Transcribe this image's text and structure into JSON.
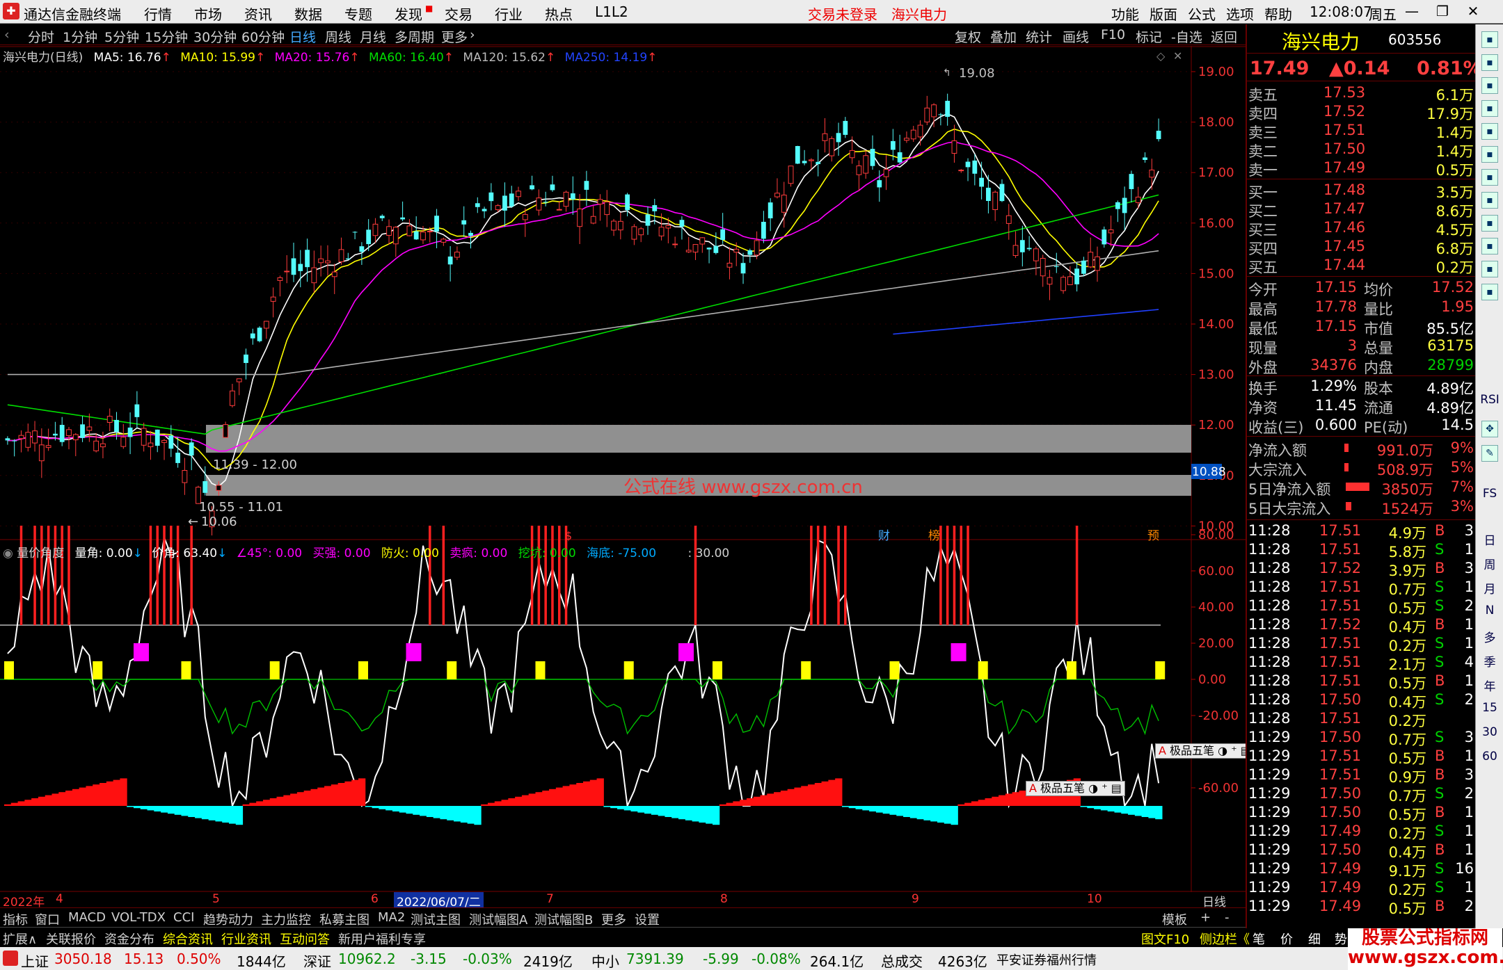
{
  "menubar": {
    "app": "通达信金融终端",
    "items": [
      "行情",
      "市场",
      "资讯",
      "数据",
      "专题",
      "发现",
      "交易",
      "行业",
      "热点",
      "L1L2"
    ],
    "notice": "交易未登录",
    "stock_link": "海兴电力",
    "right": [
      "功能",
      "版面",
      "公式",
      "选项",
      "帮助"
    ],
    "time": "12:08:07",
    "weekday": "周五"
  },
  "periods": [
    "分时",
    "1分钟",
    "5分钟",
    "15分钟",
    "30分钟",
    "60分钟",
    "日线",
    "周线",
    "月线",
    "多周期",
    "更多"
  ],
  "active_period": "日线",
  "toolbar": [
    "复权",
    "叠加",
    "统计",
    "画线",
    "F10",
    "标记",
    "-自选",
    "返回"
  ],
  "ma_legend": {
    "title": "海兴电力(日线)",
    "ma5": "MA5: 16.76",
    "ma10": "MA10: 15.99",
    "ma20": "MA20: 15.76",
    "ma60": "MA60: 16.40",
    "ma120": "MA120: 15.62",
    "ma250": "MA250: 14.19"
  },
  "price_axis": [
    "19.00",
    "18.00",
    "17.00",
    "16.00",
    "15.00",
    "14.00",
    "13.00",
    "12.00",
    "11.00",
    "10.00"
  ],
  "current_price_tag": "10.88",
  "chart_labels": {
    "high": "19.08",
    "zone1": "11.39 - 12.00",
    "zone2": "10.55 - 11.01",
    "low": "10.06"
  },
  "event_marks": [
    "财",
    "榜",
    "预",
    "$"
  ],
  "indicator_legend": {
    "name": "量价角度",
    "a": "量角: 0.00",
    "b": "价角: 63.40",
    "c": "∠45°: 0.00",
    "d": "买强: 0.00",
    "e": "防火: 0.00",
    "f": "卖疯: 0.00",
    "g": "挖坑: 0.00",
    "h": "海底: -75.00",
    "i": ": 30.00"
  },
  "ind_axis": [
    "80.00",
    "60.00",
    "40.00",
    "20.00",
    "0.00",
    "-20.00",
    "-40.00",
    "-60.00"
  ],
  "floating": [
    "极品五笔",
    "极品五笔"
  ],
  "date_axis": {
    "year": "2022年",
    "m4": "4",
    "m5": "5",
    "m6": "6",
    "m7": "7",
    "m8": "8",
    "m9": "9",
    "m10": "10",
    "cursor": "2022/06/07/二",
    "period": "日线"
  },
  "tabs1": [
    "指标",
    "窗口",
    "MACD",
    "VOL-TDX",
    "CCI",
    "趋势动力",
    "主力监控",
    "私募主图",
    "MA2",
    "测试主图",
    "测试幅图A",
    "测试幅图B",
    "更多",
    "设置"
  ],
  "tabs1_right": [
    "模板",
    "+",
    "-"
  ],
  "tabs2": [
    "扩展∧",
    "关联报价",
    "资金分布",
    "综合资讯",
    "行业资讯",
    "互动问答",
    "新用户福利专享"
  ],
  "tabs2_right": [
    "图文F10",
    "侧边栏《",
    "笔",
    "价",
    "细",
    "势"
  ],
  "status": {
    "sh_label": "上证",
    "sh": "3050.18",
    "sh_chg": "15.13",
    "sh_pct": "0.50%",
    "sh_amt": "1844亿",
    "sz_label": "深证",
    "sz": "10962.2",
    "sz_chg": "-3.15",
    "sz_pct": "-0.03%",
    "sz_amt": "2419亿",
    "zx_label": "中小",
    "zx": "7391.39",
    "zx_chg": "-5.99",
    "zx_pct": "-0.08%",
    "zx_amt": "264.1亿",
    "total_label": "总成交",
    "total": "4263亿",
    "broker": "平安证券福州行情"
  },
  "watermark": "公式在线  www.gszx.com.cn",
  "watermark2": "股票公式指标网 www.gszx.com.cn",
  "quote": {
    "name": "海兴电力",
    "code": "603556",
    "price": "17.49",
    "change": "▲0.14",
    "pct": "0.81%",
    "asks": [
      {
        "l": "卖五",
        "p": "17.53",
        "v": "6.1万"
      },
      {
        "l": "卖四",
        "p": "17.52",
        "v": "17.9万"
      },
      {
        "l": "卖三",
        "p": "17.51",
        "v": "1.4万"
      },
      {
        "l": "卖二",
        "p": "17.50",
        "v": "1.4万"
      },
      {
        "l": "卖一",
        "p": "17.49",
        "v": "0.5万"
      }
    ],
    "bids": [
      {
        "l": "买一",
        "p": "17.48",
        "v": "3.5万"
      },
      {
        "l": "买二",
        "p": "17.47",
        "v": "8.6万"
      },
      {
        "l": "买三",
        "p": "17.46",
        "v": "4.5万"
      },
      {
        "l": "买四",
        "p": "17.45",
        "v": "6.8万"
      },
      {
        "l": "买五",
        "p": "17.44",
        "v": "0.2万"
      }
    ],
    "stats": [
      {
        "a": "今开",
        "b": "17.15",
        "c": "均价",
        "d": "17.52"
      },
      {
        "a": "最高",
        "b": "17.78",
        "c": "量比",
        "d": "1.95"
      },
      {
        "a": "最低",
        "b": "17.15",
        "c": "市值",
        "d": "85.5亿"
      },
      {
        "a": "现量",
        "b": "3",
        "c": "总量",
        "d": "63175"
      },
      {
        "a": "外盘",
        "b": "34376",
        "c": "内盘",
        "d": "28799"
      }
    ],
    "stats2": [
      {
        "a": "换手",
        "b": "1.29%",
        "c": "股本",
        "d": "4.89亿"
      },
      {
        "a": "净资",
        "b": "11.45",
        "c": "流通",
        "d": "4.89亿"
      },
      {
        "a": "收益(三)",
        "b": "0.600",
        "c": "PE(动)",
        "d": "14.5"
      }
    ],
    "flows": [
      {
        "a": "净流入额",
        "b": "991.0万",
        "c": "9%"
      },
      {
        "a": "大宗流入",
        "b": "508.9万",
        "c": "5%"
      },
      {
        "a": "5日净流入额",
        "b": "3850万",
        "c": "7%"
      },
      {
        "a": "5日大宗流入",
        "b": "1524万",
        "c": "3%"
      }
    ],
    "ticks": [
      [
        "11:28",
        "17.51",
        "4.9万",
        "B",
        "3"
      ],
      [
        "11:28",
        "17.51",
        "5.8万",
        "S",
        "1"
      ],
      [
        "11:28",
        "17.52",
        "3.9万",
        "B",
        "3"
      ],
      [
        "11:28",
        "17.51",
        "0.7万",
        "S",
        "1"
      ],
      [
        "11:28",
        "17.51",
        "0.5万",
        "S",
        "2"
      ],
      [
        "11:28",
        "17.52",
        "0.4万",
        "B",
        "1"
      ],
      [
        "11:28",
        "17.51",
        "0.2万",
        "S",
        "1"
      ],
      [
        "11:28",
        "17.51",
        "2.1万",
        "S",
        "4"
      ],
      [
        "11:28",
        "17.51",
        "0.5万",
        "B",
        "1"
      ],
      [
        "11:28",
        "17.50",
        "0.4万",
        "S",
        "2"
      ],
      [
        "11:28",
        "17.51",
        "0.2万",
        "",
        ""
      ],
      [
        "11:29",
        "17.50",
        "0.7万",
        "S",
        "3"
      ],
      [
        "11:29",
        "17.51",
        "0.5万",
        "B",
        "1"
      ],
      [
        "11:29",
        "17.51",
        "0.9万",
        "B",
        "3"
      ],
      [
        "11:29",
        "17.50",
        "0.7万",
        "S",
        "2"
      ],
      [
        "11:29",
        "17.50",
        "0.5万",
        "B",
        "1"
      ],
      [
        "11:29",
        "17.49",
        "0.2万",
        "S",
        "1"
      ],
      [
        "11:29",
        "17.50",
        "0.4万",
        "B",
        "1"
      ],
      [
        "11:29",
        "17.49",
        "9.1万",
        "S",
        "16"
      ],
      [
        "11:29",
        "17.49",
        "0.2万",
        "S",
        "1"
      ],
      [
        "11:29",
        "17.49",
        "0.5万",
        "B",
        "2"
      ]
    ]
  },
  "side_icons": [
    "日",
    "周",
    "月",
    "N",
    "多",
    "季",
    "年",
    "15",
    "30",
    "60",
    "RSI",
    "FS"
  ]
}
